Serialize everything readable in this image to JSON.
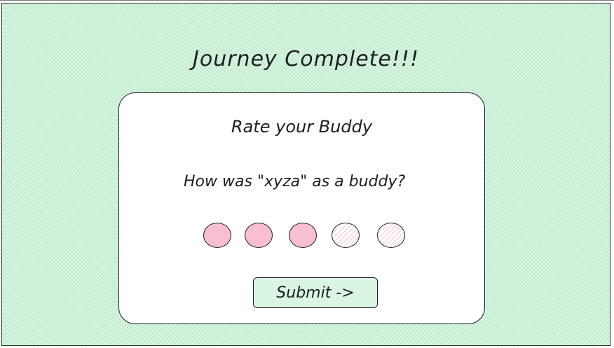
{
  "page": {
    "title": "Journey Complete!!!"
  },
  "card": {
    "title": "Rate your Buddy",
    "question": "How was \"xyza\" as a buddy?",
    "rating": {
      "value": 3,
      "max": 5,
      "filled_color": "#f7bfd0",
      "empty_color": "#ffffff"
    },
    "submit_label": "Submit ->"
  },
  "colors": {
    "background": "#d9f6e3",
    "card": "#ffffff",
    "accent": "#f7bfd0",
    "stroke": "#1e1e1e"
  }
}
